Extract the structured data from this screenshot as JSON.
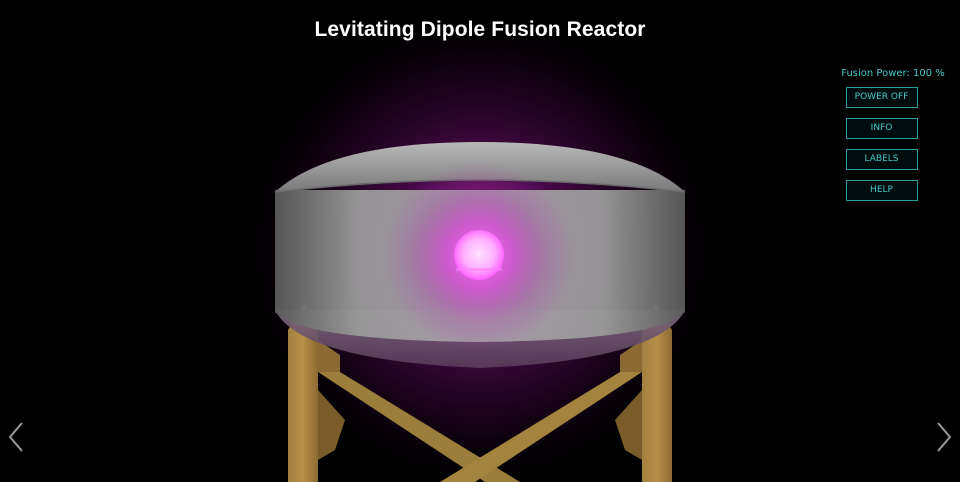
{
  "header": {
    "title": "Levitating Dipole Fusion Reactor"
  },
  "controls": {
    "power_readout": "Fusion Power: 100 %",
    "power_off_label": "POWER OFF",
    "info_label": "INFO",
    "labels_label": "LABELS",
    "help_label": "HELP"
  },
  "navigation": {
    "previous_icon": "chevron-left-icon",
    "next_icon": "chevron-right-icon"
  },
  "colors": {
    "background": "#000000",
    "accent": "#46c8c8",
    "plasma": "#ff4dff",
    "glow": "#6a0a6a",
    "chamber": "#8a8a8a",
    "support": "#9a7a3a"
  }
}
